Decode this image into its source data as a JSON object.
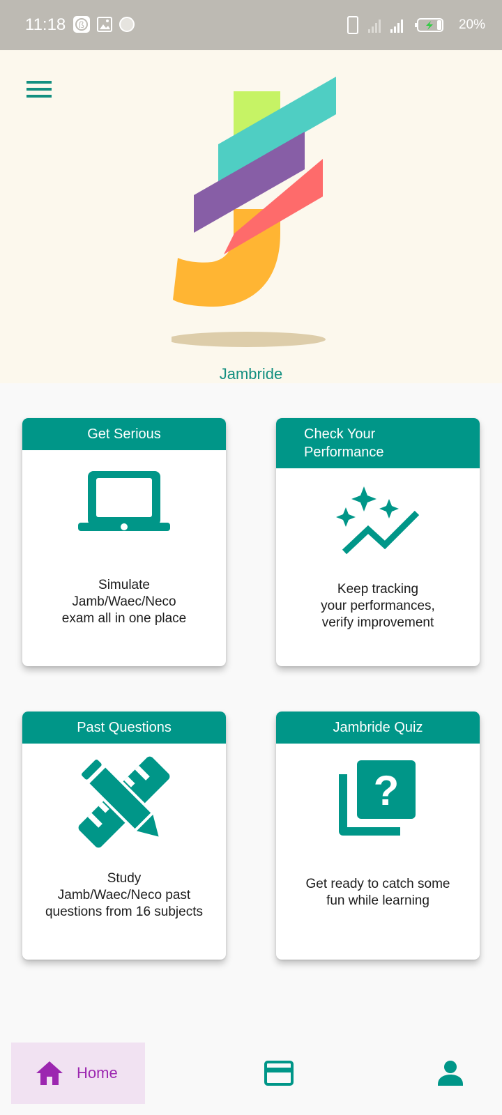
{
  "status_bar": {
    "time": "11:18",
    "battery_percent": "20%",
    "icons": [
      "b-badge-icon",
      "image-icon",
      "circle-icon",
      "phone-icon",
      "signal-icon",
      "battery-charging-icon"
    ]
  },
  "header": {
    "app_name": "Jambride",
    "menu_icon": "menu-icon",
    "logo_colors": [
      "#c6f365",
      "#4fcec3",
      "#875ea6",
      "#fe6b6b",
      "#ffb533"
    ]
  },
  "cards": [
    {
      "title": "Get Serious",
      "icon": "laptop-icon",
      "description": [
        "Simulate",
        "Jamb/Waec/Neco",
        "exam all in one place"
      ]
    },
    {
      "title": [
        "Check Your",
        "Performance"
      ],
      "icon": "auto-graph-icon",
      "description": [
        "Keep tracking",
        "your performances,",
        "verify improvement"
      ]
    },
    {
      "title": "Past Questions",
      "icon": "pencil-ruler-icon",
      "description": [
        "Study",
        "Jamb/Waec/Neco past",
        "questions from 16 subjects"
      ]
    },
    {
      "title": "Jambride Quiz",
      "icon": "quiz-icon",
      "description": [
        "Get ready to catch some",
        "fun while learning"
      ]
    }
  ],
  "bottom_nav": {
    "items": [
      {
        "label": "Home",
        "icon": "home-icon",
        "active": true
      },
      {
        "label": "",
        "icon": "card-icon",
        "active": false
      },
      {
        "label": "",
        "icon": "person-icon",
        "active": false
      }
    ]
  },
  "colors": {
    "primary": "#009688",
    "accent": "#9c27b0",
    "header_bg": "#fcf8ed",
    "status_bar_bg": "#bdbab3"
  }
}
